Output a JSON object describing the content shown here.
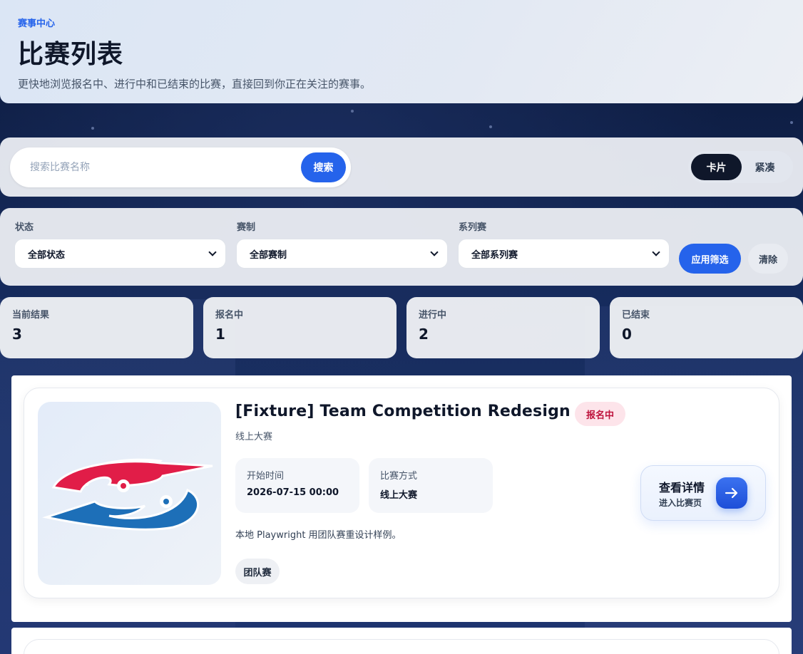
{
  "hero": {
    "eyebrow": "赛事中心",
    "title": "比赛列表",
    "subtitle": "更快地浏览报名中、进行中和已结束的比赛，直接回到你正在关注的赛事。"
  },
  "search": {
    "placeholder": "搜索比赛名称",
    "value": "",
    "button_label": "搜索"
  },
  "view_toggle": {
    "options": [
      "卡片",
      "紧凑"
    ],
    "selected": "卡片"
  },
  "filters": {
    "status": {
      "label": "状态",
      "value": "全部状态"
    },
    "format": {
      "label": "赛制",
      "value": "全部赛制"
    },
    "series": {
      "label": "系列赛",
      "value": "全部系列赛"
    },
    "apply_label": "应用筛选",
    "clear_label": "清除"
  },
  "stats": [
    {
      "label": "当前结果",
      "value": "3"
    },
    {
      "label": "报名中",
      "value": "1"
    },
    {
      "label": "进行中",
      "value": "2"
    },
    {
      "label": "已结束",
      "value": "0"
    }
  ],
  "competitions": [
    {
      "title": "[Fixture] Team Competition Redesign",
      "status_badge": "报名中",
      "subtitle": "线上大赛",
      "start_label": "开始时间",
      "start_value": "2026-07-15 00:00",
      "mode_label": "比赛方式",
      "mode_value": "线上大赛",
      "description": "本地 Playwright 用团队赛重设计样例。",
      "tag": "团队赛",
      "detail_title": "查看详情",
      "detail_sub": "进入比赛页"
    }
  ],
  "colors": {
    "accent": "#2563eb",
    "badge_bg": "#fde4ea",
    "badge_text": "#be123c",
    "dark": "#0f172a"
  }
}
